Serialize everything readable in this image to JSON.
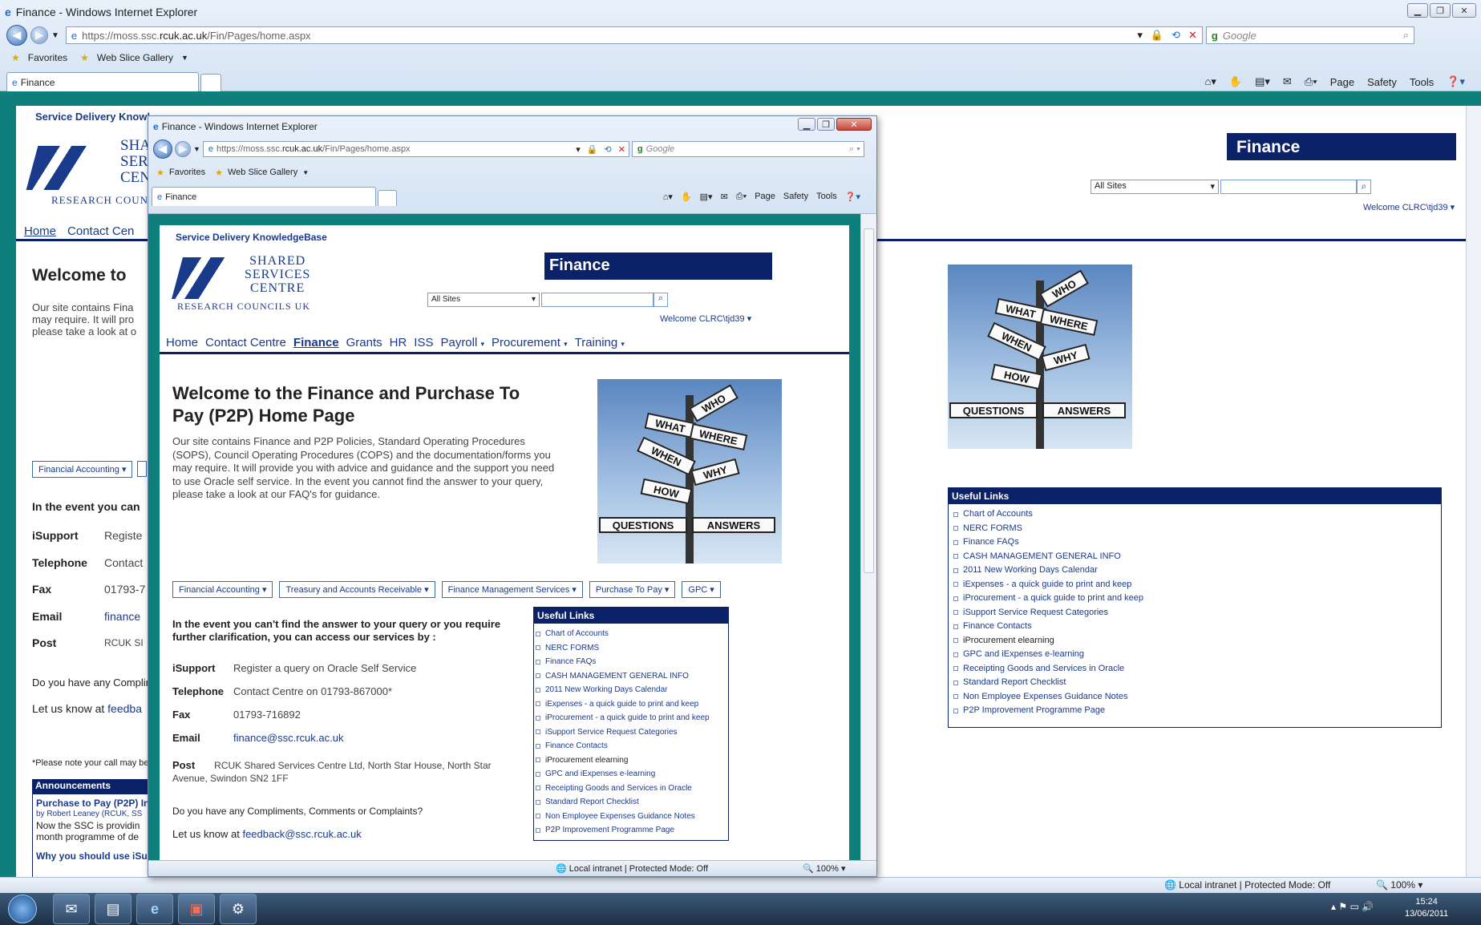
{
  "outer": {
    "title": "Finance - Windows Internet Explorer",
    "url_prefix": "https://moss.ssc.",
    "url_domain": "rcuk.ac.uk",
    "url_path": "/Fin/Pages/home.aspx",
    "search_placeholder": "Google",
    "favorites": "Favorites",
    "web_slice": "Web Slice Gallery",
    "tab_label": "Finance",
    "cmd": [
      "Page",
      "Safety",
      "Tools"
    ],
    "status": "Local intranet | Protected Mode: Off",
    "zoom": "100%"
  },
  "bg_site": {
    "kb_title": "Service Delivery Knowl",
    "finance_banner": "Finance",
    "search_scope": "All Sites",
    "welcome_user": "Welcome CLRC\\tjd39",
    "nav_home": "Home",
    "nav_contact": "Contact Cen",
    "logo_sh": "SHA",
    "logo_ser": "SER",
    "logo_cen": "CEN",
    "logo_research": "RESEARCH COUNC",
    "welcome_partial": "Welcome to",
    "intro_lines": [
      "Our site contains Fina",
      "may require.   It will pro",
      "please take a look at o"
    ],
    "dd_financial": "Financial Accounting",
    "event_partial": "In the event you can",
    "contacts": [
      {
        "label": "iSupport",
        "value": "Registe"
      },
      {
        "label": "Telephone",
        "value": "Contact"
      },
      {
        "label": "Fax",
        "value": "01793-7"
      },
      {
        "label": "Email",
        "value": "finance"
      },
      {
        "label": "Post",
        "value": "RCUK SI"
      }
    ],
    "compliments_partial": "Do you have any Complin",
    "let_us_know": "Let us know at ",
    "feedback_partial": "feedba",
    "note_partial": "*Please note your call may be",
    "announcements": "Announcements",
    "ann_title": "Purchase to Pay (P2P) In",
    "ann_by": "by Robert Leaney (RCUK, SS",
    "ann_line1": "Now the SSC is providin",
    "ann_line2": "month programme of de",
    "ann2_title": "Why you should use iSup"
  },
  "inner": {
    "title": "Finance - Windows Internet Explorer",
    "url_prefix": "https://moss.ssc.",
    "url_domain": "rcuk.ac.uk",
    "url_path": "/Fin/Pages/home.aspx",
    "search_placeholder": "Google",
    "favorites": "Favorites",
    "web_slice": "Web Slice Gallery",
    "tab_label": "Finance",
    "cmd": [
      "Page",
      "Safety",
      "Tools"
    ],
    "status": "Local intranet | Protected Mode: Off",
    "zoom": "100%"
  },
  "site": {
    "kb_title": "Service Delivery KnowledgeBase",
    "logo_lines": [
      "SHARED",
      "SERVICES",
      "CENTRE"
    ],
    "logo_sub": "RESEARCH COUNCILS UK",
    "finance_banner": "Finance",
    "search_scope": "All Sites",
    "welcome_user": "Welcome CLRC\\tjd39",
    "nav": [
      "Home",
      "Contact Centre",
      "Finance",
      "Grants",
      "HR",
      "ISS",
      "Payroll",
      "Procurement",
      "Training"
    ],
    "heading_line1": "Welcome to the Finance and Purchase To",
    "heading_line2": "Pay (P2P) Home Page",
    "intro": "Our site contains Finance and P2P Policies, Standard Operating Procedures (SOPS), Council Operating Procedures (COPS) and the documentation/forms you may require.   It will provide you with advice and guidance and the support you need to use Oracle self service. In the event you cannot find the answer to your query, please take a look at our FAQ's for guidance.",
    "dropdowns": [
      "Financial Accounting",
      "Treasury and Accounts Receivable",
      "Finance Management Services",
      "Purchase To Pay",
      "GPC"
    ],
    "event_text": "In the event you can't find the answer to your query or you require further clarification, you can access our services by :",
    "contacts": [
      {
        "label": "iSupport",
        "value": "Register a query on Oracle Self Service"
      },
      {
        "label": "Telephone",
        "value": "Contact Centre on 01793-867000*"
      },
      {
        "label": "Fax",
        "value": "01793-716892"
      },
      {
        "label": "Email",
        "value": "finance@ssc.rcuk.ac.uk"
      }
    ],
    "post_label": "Post",
    "post_value": "RCUK Shared Services Centre Ltd, North Star House, North Star Avenue, Swindon  SN2 1FF",
    "compliments": "Do you have any Compliments, Comments or Complaints?",
    "let_us_know": "Let us know at ",
    "feedback_link": "feedback@ssc.rcuk.ac.uk"
  },
  "signpost": {
    "arms": [
      "WHO",
      "WHAT",
      "WHERE",
      "WHEN",
      "WHY",
      "HOW",
      "QUESTIONS",
      "ANSWERS"
    ]
  },
  "useful_links": {
    "heading": "Useful Links",
    "items": [
      "Chart of Accounts",
      "NERC FORMS",
      "Finance FAQs",
      "CASH MANAGEMENT GENERAL INFO",
      "2011 New Working Days Calendar",
      "iExpenses - a quick guide to print and keep",
      "iProcurement - a quick guide to print and keep",
      "iSupport Service Request Categories",
      "Finance Contacts",
      "iProcurement elearning",
      "GPC and iExpenses e-learning",
      "Receipting Goods and Services in Oracle",
      "Standard Report Checklist",
      "Non Employee Expenses Guidance Notes",
      "P2P Improvement Programme Page"
    ]
  },
  "taskbar": {
    "time": "15:24",
    "date": "13/06/2011"
  }
}
